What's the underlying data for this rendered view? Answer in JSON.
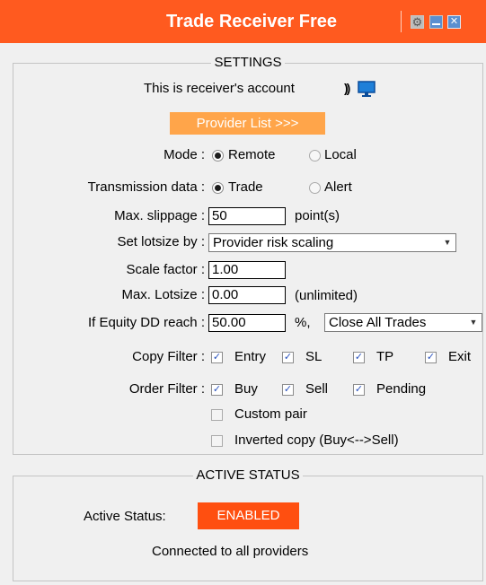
{
  "window": {
    "title": "Trade Receiver Free",
    "icons": [
      "gear-icon",
      "minimize-icon",
      "close-icon"
    ]
  },
  "settings": {
    "heading": "SETTINGS",
    "account_text": "This is receiver's account",
    "account_icons": [
      "signal-icon",
      "monitor-icon"
    ],
    "provider_button": "Provider List >>>",
    "mode": {
      "label": "Mode :",
      "options": [
        "Remote",
        "Local"
      ],
      "selected": "Remote"
    },
    "transmission": {
      "label": "Transmission data :",
      "options": [
        "Trade",
        "Alert"
      ],
      "selected": "Trade"
    },
    "max_slippage": {
      "label": "Max. slippage :",
      "value": "50",
      "unit": "point(s)"
    },
    "lotsize": {
      "label": "Set lotsize by :",
      "value": "Provider risk scaling"
    },
    "scale_factor": {
      "label": "Scale factor :",
      "value": "1.00"
    },
    "max_lotsize": {
      "label": "Max. Lotsize :",
      "value": "0.00",
      "note": "(unlimited)"
    },
    "equity_dd": {
      "label": "If Equity DD reach :",
      "value": "50.00",
      "unit": "%,",
      "action": "Close All Trades"
    },
    "copy_filter": {
      "label": "Copy Filter :",
      "items": [
        {
          "label": "Entry",
          "checked": true
        },
        {
          "label": "SL",
          "checked": true
        },
        {
          "label": "TP",
          "checked": true
        },
        {
          "label": "Exit",
          "checked": true
        }
      ]
    },
    "order_filter": {
      "label": "Order Filter :",
      "items": [
        {
          "label": "Buy",
          "checked": true
        },
        {
          "label": "Sell",
          "checked": true
        },
        {
          "label": "Pending",
          "checked": true
        }
      ]
    },
    "custom_pair": {
      "label": "Custom pair",
      "checked": false
    },
    "inverted_copy": {
      "label": "Inverted copy (Buy<-->Sell)",
      "checked": false
    }
  },
  "active": {
    "heading": "ACTIVE STATUS",
    "label": "Active Status:",
    "status": "ENABLED",
    "message": "Connected to all providers"
  },
  "colors": {
    "titlebar": "#ff5a1f",
    "provider_button": "#ffa54a",
    "enabled_badge": "#ff4f10",
    "background": "#f0f0f0"
  }
}
